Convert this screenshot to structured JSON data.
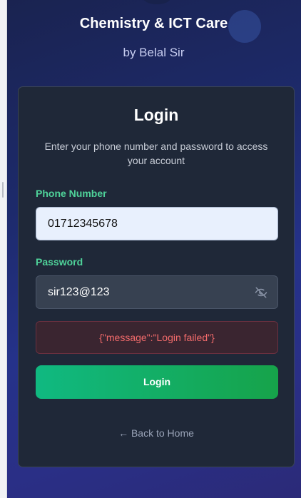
{
  "brand": {
    "title": "Chemistry & ICT Care",
    "subtitle": "by Belal Sir"
  },
  "login_card": {
    "title": "Login",
    "description": "Enter your phone number and password to access your account",
    "phone": {
      "label": "Phone Number",
      "value": "01712345678"
    },
    "password": {
      "label": "Password",
      "value": "sir123@123",
      "toggle_icon": "eye-off-icon"
    },
    "error_message": "{\"message\":\"Login failed\"}",
    "submit_label": "Login",
    "back_link": "← Back to Home"
  },
  "colors": {
    "accent_green": "#10b981",
    "label_green": "#4fd39a",
    "error_red": "#f36b6b",
    "card_bg": "#1f2838"
  }
}
